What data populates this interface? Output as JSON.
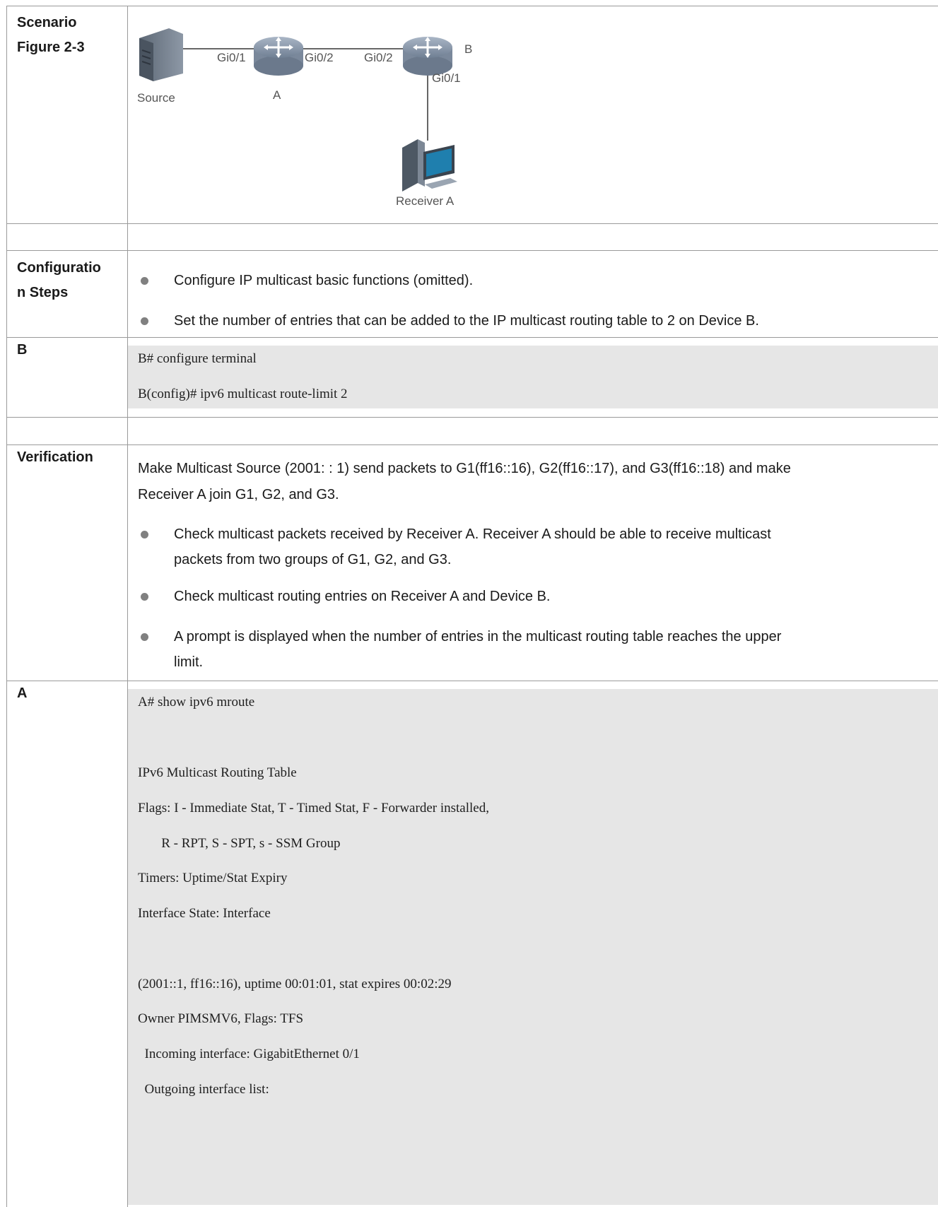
{
  "rows": {
    "scenario": {
      "label1": "Scenario",
      "label2": "Figure 2-3"
    },
    "config_steps": {
      "label1": "Configuratio",
      "label2": "n Steps",
      "bullets": [
        "Configure IP multicast basic functions (omitted).",
        "Set the number of entries that can be added to the IP multicast routing table to 2 on Device B."
      ]
    },
    "b": {
      "label": "B",
      "code": [
        "B# configure terminal",
        "B(config)# ipv6 multicast route-limit 2"
      ]
    },
    "verification": {
      "label": "Verification",
      "intro_line1": "Make Multicast Source (2001: : 1) send packets to G1(ff16::16), G2(ff16::17), and G3(ff16::18) and make",
      "intro_line2": "Receiver A join G1, G2, and G3.",
      "bullets": [
        {
          "line1": "Check multicast packets received by Receiver A. Receiver A should be able to receive multicast",
          "line2": "packets from two groups of G1, G2, and G3."
        },
        {
          "line1": "Check multicast routing entries on Receiver A and Device B.",
          "line2": ""
        },
        {
          "line1": "A prompt is displayed when the number of entries in the multicast routing table reaches the upper",
          "line2": "limit."
        }
      ]
    },
    "a": {
      "label": "A",
      "code": [
        "A# show ipv6 mroute",
        "",
        "IPv6 Multicast Routing Table",
        "Flags: I - Immediate Stat, T - Timed Stat, F - Forwarder installed,",
        "       R - RPT, S - SPT, s - SSM Group",
        "Timers: Uptime/Stat Expiry",
        "Interface State: Interface",
        "",
        "(2001::1, ff16::16), uptime 00:01:01, stat expires 00:02:29",
        "Owner PIMSMV6, Flags: TFS",
        "  Incoming interface: GigabitEthernet 0/1",
        "  Outgoing interface list:"
      ]
    }
  },
  "diagram": {
    "source": "Source",
    "router_a": "A",
    "router_b": "B",
    "receiver": "Receiver A",
    "ports": {
      "a_left": "Gi0/1",
      "a_right": "Gi0/2",
      "b_left": "Gi0/2",
      "b_down": "Gi0/1"
    }
  }
}
